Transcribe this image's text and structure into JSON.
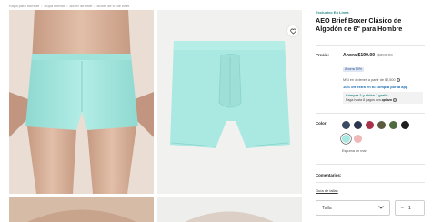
{
  "breadcrumb": [
    "Ropa para hombre",
    "Ropa interior",
    "Bóxer de brief",
    "Bóxer de 6\" de Brief"
  ],
  "gallery": {
    "accent_color": "#a8e8e0"
  },
  "product": {
    "exclusive_label": "Exclusivo En Línea",
    "title": "AEO Brief Boxer Clásico de Algodón de 6\" para Hombre"
  },
  "price": {
    "label": "Precio:",
    "current": "Ahora $199.00",
    "original": "$399.00",
    "discount_badge": "Ahorra 50%",
    "msi_text": "MSI en órdenes a partir de $2,500",
    "app_promo": "10% off extra en tu compra por la app",
    "promo_main": "Compra 2 y obtén 1 gratis",
    "promo_sub_prefix": "Paga hasta 8 pagos con",
    "promo_sub_brand": "aplazo"
  },
  "colors": {
    "label": "Color:",
    "swatches": [
      {
        "name": "pattern-dark",
        "hex": "#3a4b63"
      },
      {
        "name": "graphic-navy",
        "hex": "#2d3550"
      },
      {
        "name": "cherry-red",
        "hex": "#a8324a"
      },
      {
        "name": "olive",
        "hex": "#5c5a3e"
      },
      {
        "name": "camo-green",
        "hex": "#4f6b3f"
      },
      {
        "name": "black",
        "hex": "#1e1e1e"
      },
      {
        "name": "aqua",
        "hex": "#a8e8e0"
      },
      {
        "name": "pink",
        "hex": "#f0b7b9"
      }
    ],
    "selected_index": 6,
    "selected_name": "Espuma de mar"
  },
  "comments_label": "Comentarios:",
  "size_guide_label": "Guía de tallas",
  "size_select": {
    "value": "Talla"
  },
  "quantity": {
    "value": "1",
    "minus": "−",
    "plus": "+"
  }
}
